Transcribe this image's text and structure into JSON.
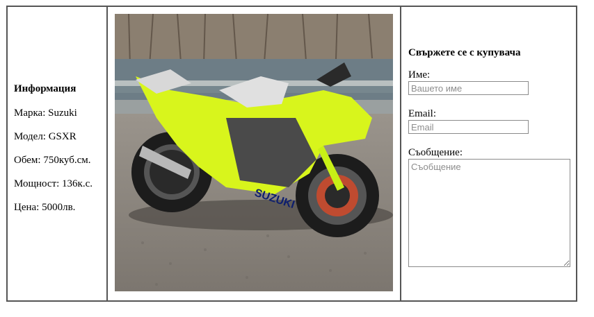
{
  "info": {
    "heading": "Информация",
    "brand": "Марка: Suzuki",
    "model": "Модел: GSXR",
    "volume": "Обем: 750куб.см.",
    "power": "Мощност: 136к.с.",
    "price": "Цена: 5000лв."
  },
  "photo": {
    "alt": "Suzuki GSXR",
    "tank_text": "SUZUKI",
    "colors": {
      "neon": "#d8f51c",
      "sky": "#c9d2d6",
      "water": "#6d7d86",
      "ground": "#8a847d"
    }
  },
  "contact": {
    "heading": "Свържете се с купувача",
    "name_label": "Име:",
    "name_placeholder": "Вашето име",
    "email_label": "Email:",
    "email_placeholder": "Email",
    "message_label": "Съобщение:",
    "message_placeholder": "Съобщение"
  }
}
